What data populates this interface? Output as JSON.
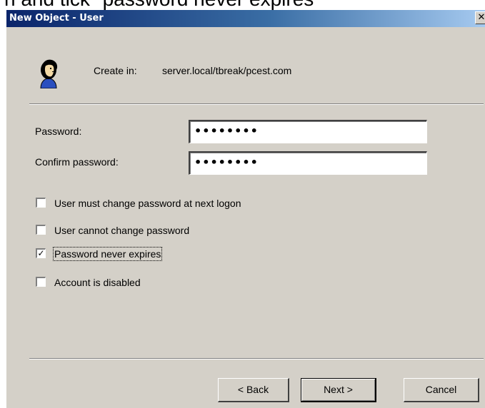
{
  "caption_fragment": "n and tick \"password never expires\"",
  "window": {
    "title": "New Object - User",
    "close_glyph": "✕"
  },
  "header": {
    "icon": "user-icon",
    "create_in_label": "Create in:",
    "create_in_value": "server.local/tbreak/pcest.com"
  },
  "fields": {
    "password_label": "Password:",
    "password_value": "••••••••",
    "confirm_label": "Confirm password:",
    "confirm_value": "••••••••"
  },
  "options": [
    {
      "label": "User must change password at next logon",
      "checked": false,
      "mark": ""
    },
    {
      "label": "User cannot change password",
      "checked": false,
      "mark": ""
    },
    {
      "label": "Password never expires",
      "checked": true,
      "mark": "✓"
    },
    {
      "label": "Account is disabled",
      "checked": false,
      "mark": ""
    }
  ],
  "buttons": {
    "back": "< Back",
    "next": "Next >",
    "cancel": "Cancel"
  },
  "colors": {
    "titlebar_start": "#0a246a",
    "titlebar_end": "#a6caf0",
    "dialog_face": "#d4d0c8"
  }
}
